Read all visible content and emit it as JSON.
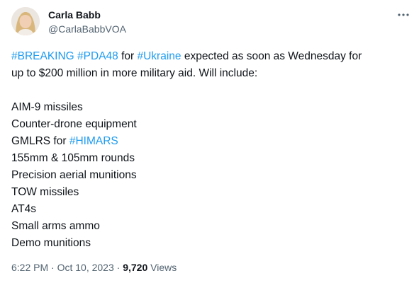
{
  "author": {
    "display_name": "Carla Babb",
    "handle": "@CarlaBabbVOA"
  },
  "more_icon": "more-horizontal-icon",
  "colors": {
    "text": "#0f1419",
    "secondary": "#536471",
    "hashtag": "#1d9bf0"
  },
  "tweet": {
    "line1": {
      "tag1": "#BREAKING",
      "sp1": " ",
      "tag2": "#PDA48",
      "t1": " for ",
      "tag3": "#Ukraine",
      "t2": " expected as soon as Wednesday for"
    },
    "line2": "up to $200 million in more military aid. Will include:",
    "items": [
      "AIM-9 missiles",
      "Counter-drone equipment",
      "GMLRS for ",
      "155mm & 105mm rounds",
      "Precision aerial munitions",
      "TOW missiles",
      "AT4s",
      "Small arms ammo",
      "Demo munitions"
    ],
    "himars_tag": "#HIMARS"
  },
  "meta": {
    "time": "6:22 PM",
    "sep1": " · ",
    "date": "Oct 10, 2023",
    "sep2": " · ",
    "views_count": "9,720",
    "views_label": " Views"
  }
}
